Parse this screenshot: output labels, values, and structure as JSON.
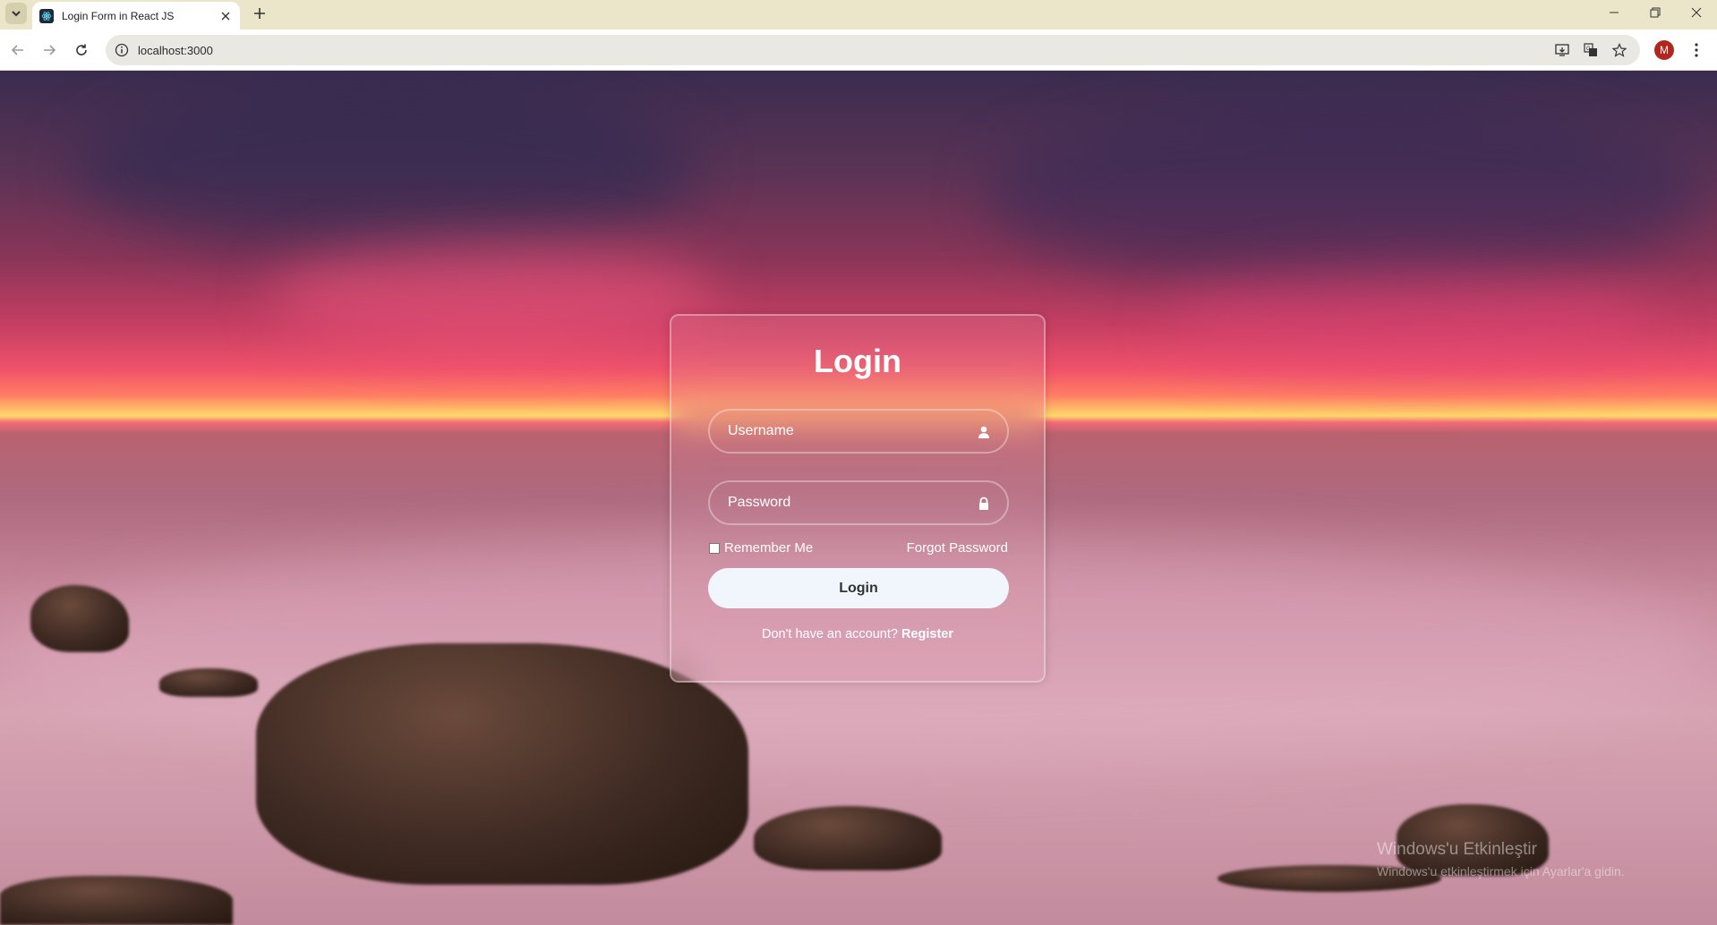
{
  "browser": {
    "tab_title": "Login Form in React JS",
    "url": "localhost:3000",
    "profile_initial": "M"
  },
  "login_form": {
    "title": "Login",
    "username_placeholder": "Username",
    "password_placeholder": "Password",
    "remember_me": "Remember Me",
    "forgot_password": "Forgot Password",
    "login_button": "Login",
    "register_prompt": "Don't have an account?",
    "register_link": "Register"
  },
  "watermark": {
    "title": "Windows'u Etkinleştir",
    "subtitle": "Windows'u etkinleştirmek için Ayarlar'a gidin."
  },
  "icons": {
    "tab_search": "chevron-down-icon",
    "favicon": "react-logo-icon",
    "close": "close-icon",
    "new_tab": "plus-icon",
    "back": "arrow-left-icon",
    "forward": "arrow-right-icon",
    "reload": "reload-icon",
    "site_info": "info-icon",
    "install": "install-app-icon",
    "translate": "translate-icon",
    "bookmark": "star-icon",
    "username": "user-icon",
    "password": "lock-icon"
  }
}
